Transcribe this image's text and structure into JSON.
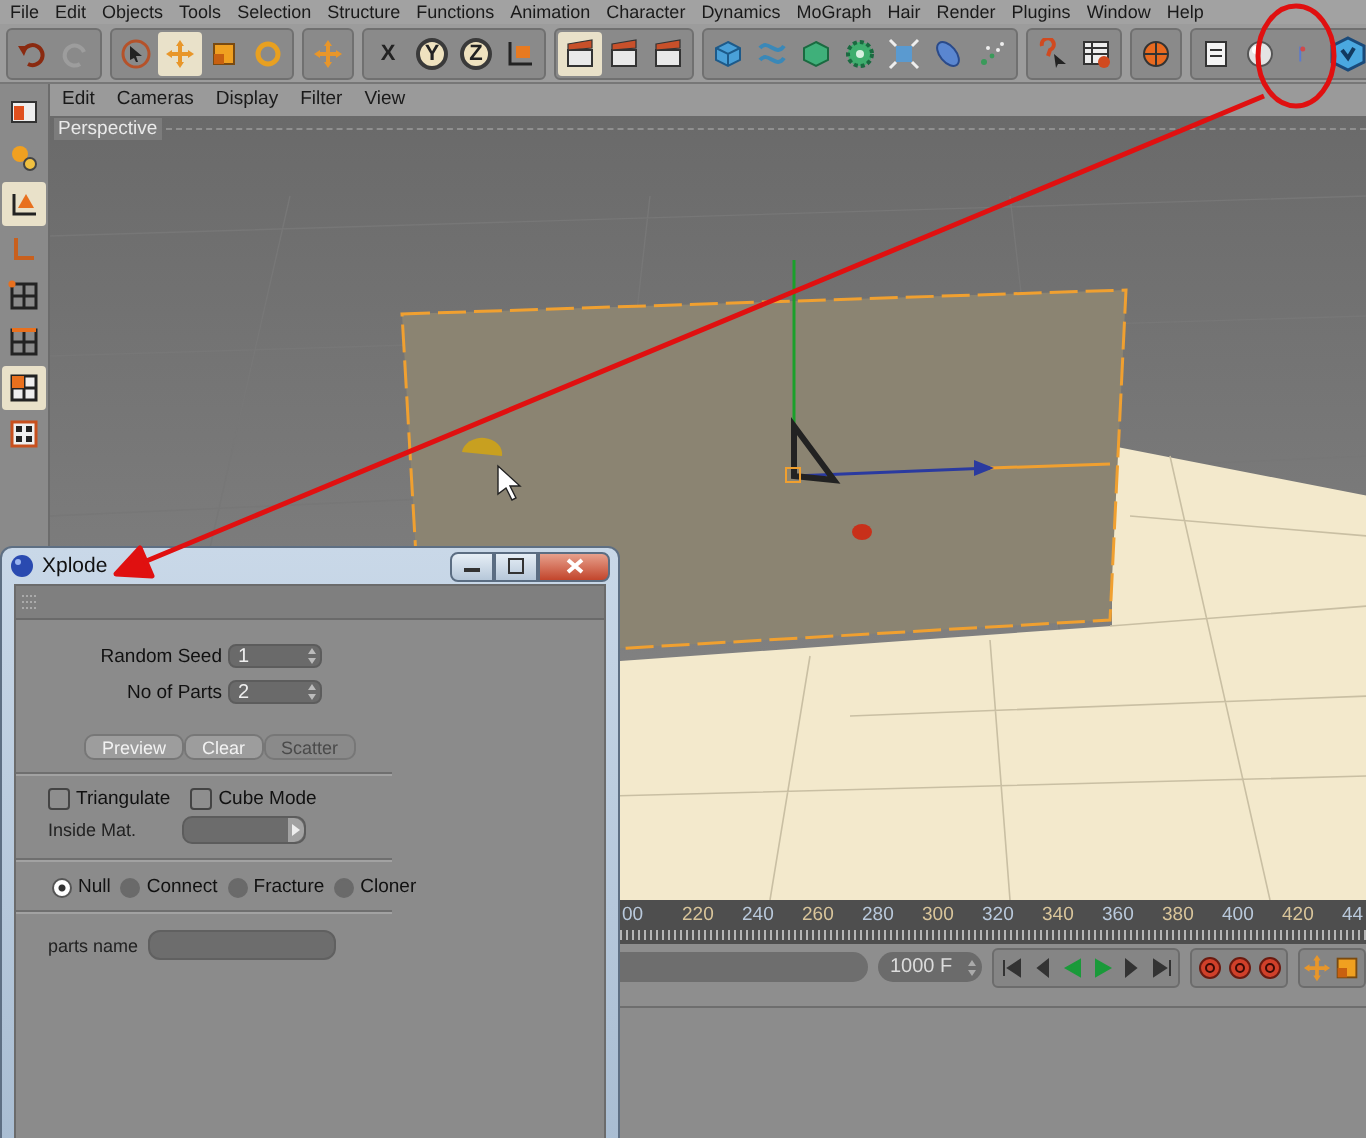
{
  "menu_bar": [
    "File",
    "Edit",
    "Objects",
    "Tools",
    "Selection",
    "Structure",
    "Functions",
    "Animation",
    "Character",
    "Dynamics",
    "MoGraph",
    "Hair",
    "Render",
    "Plugins",
    "Window",
    "Help"
  ],
  "toolbar": {
    "axes": [
      {
        "label": "X",
        "on": false
      },
      {
        "label": "Y",
        "on": true
      },
      {
        "label": "Z",
        "on": true
      }
    ]
  },
  "viewport": {
    "menu": [
      "Edit",
      "Cameras",
      "Display",
      "Filter",
      "View"
    ],
    "camera_label": "Perspective"
  },
  "timeline": {
    "ruler_labels": [
      "00",
      "220",
      "240",
      "260",
      "280",
      "300",
      "320",
      "340",
      "360",
      "380",
      "400",
      "420",
      "44"
    ],
    "end_frame": "1000 F"
  },
  "dialog": {
    "title": "Xplode",
    "fields": [
      {
        "label": "Random Seed",
        "value": "1"
      },
      {
        "label": "No of Parts",
        "value": "2"
      }
    ],
    "buttons": [
      {
        "label": "Preview",
        "disabled": false
      },
      {
        "label": "Clear",
        "disabled": false
      },
      {
        "label": "Scatter",
        "disabled": true
      }
    ],
    "checkboxes": [
      {
        "label": "Triangulate",
        "checked": false
      },
      {
        "label": "Cube Mode",
        "checked": false
      }
    ],
    "inside_mat": {
      "label": "Inside Mat."
    },
    "modes": [
      {
        "label": "Null",
        "selected": true
      },
      {
        "label": "Connect",
        "selected": false
      },
      {
        "label": "Fracture",
        "selected": false
      },
      {
        "label": "Cloner",
        "selected": false
      }
    ],
    "parts_name": {
      "label": "parts name"
    }
  }
}
